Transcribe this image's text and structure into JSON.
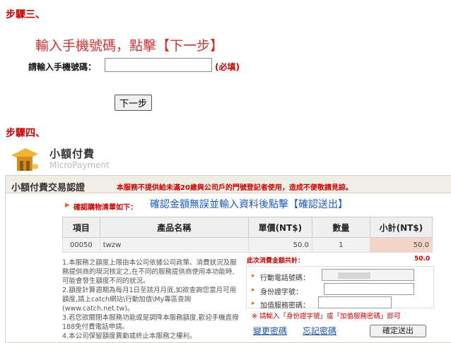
{
  "step3": {
    "title": "步驟三、",
    "instruction": "輸入手機號碼，點擊【下一步】",
    "phone_label": "請輸入手機號碼：",
    "phone_value": "",
    "required": "(必填)",
    "next_button": "下一步"
  },
  "step4": {
    "title": "步驟四、"
  },
  "logo": {
    "title": "小額付費",
    "subtitle": "MicroPayment"
  },
  "panel": {
    "title": "小額付費交易認證",
    "warning": "本服務不提供給未滿20歲與公司戶的門號登記者使用，造成不便敬請見諒。",
    "confirm_small": "確認購物清單如下：",
    "confirm_big": "確認金額無誤並輸入資料後點擊【確認送出】",
    "table": {
      "headers": [
        "項目",
        "產品名稱",
        "單價(NT$)",
        "數量",
        "小計(NT$)"
      ],
      "rows": [
        [
          "00050",
          "twzw",
          "50.0",
          "1",
          "50.0"
        ]
      ]
    },
    "total_label": "此次消費金額共計：",
    "total_value": "50.0",
    "notes": [
      "1.本服務之額度上限由本公司依據公司政策、消費狀況及服務提供商的現況核定之,在不同的服務提供商使用本功能時,可能會發生額度不同的狀況。",
      "2.額度計算週期為每月1日至該月月底,如欲查詢您當月可用額度,請上catch網站\\行動加值\\My專區查詢(www.catch.net.tw)。",
      "3.若您欲關閉本服務功能或是調降本服務額度,歡迎手機直撥188免付費電話申請。",
      "4.本公司保留額度異動或終止本服務之權利。"
    ],
    "form": {
      "phone_label": "行動電話號碼：",
      "id_label": "身份證字號：",
      "password_label": "加值服務密碼：",
      "hint": "※ 請輸入「身份證字號」或「加值服務密碼」即可"
    },
    "links": {
      "change_password": "變更密碼",
      "forgot_password": "忘記密碼"
    },
    "submit": "確定送出"
  },
  "colors": {
    "step_red": "#cc0000",
    "link_blue": "#1a4f9f",
    "subtotal_bg": "#f3d6c8"
  }
}
